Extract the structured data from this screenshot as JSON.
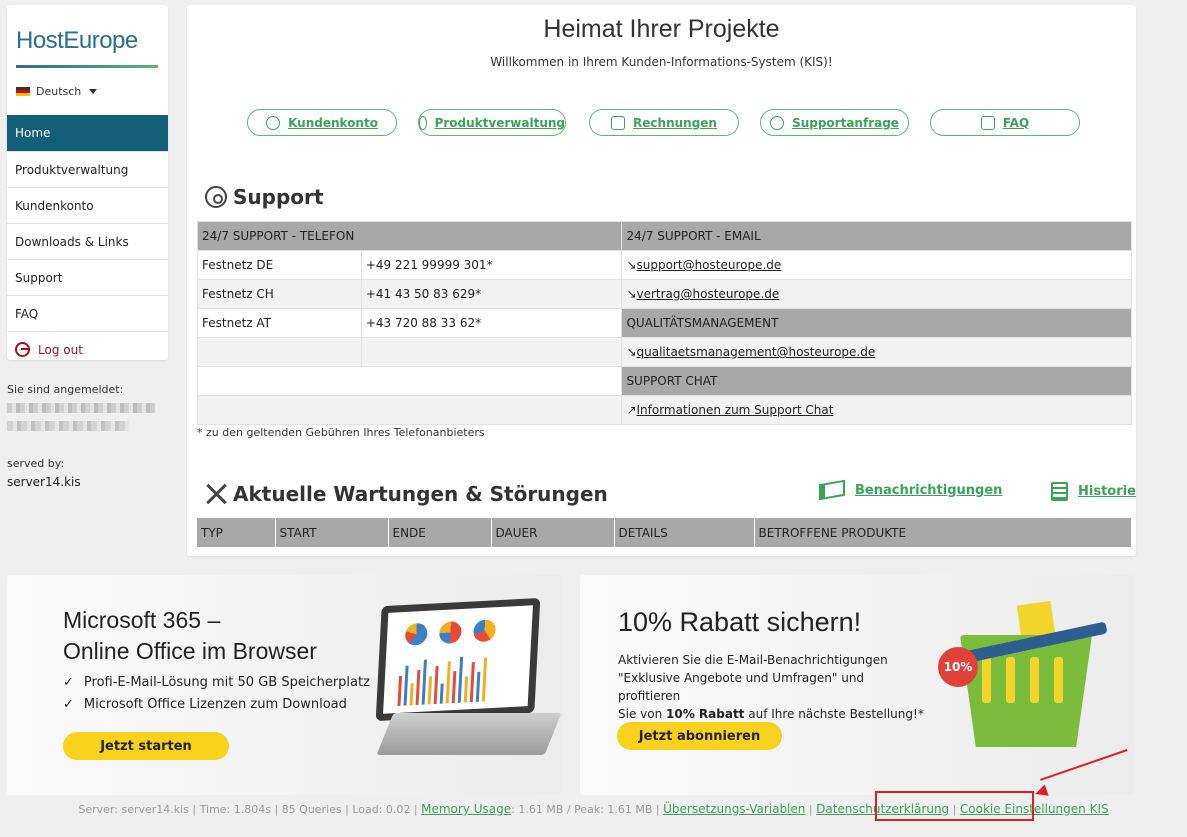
{
  "brand": {
    "logo_text": "HostEurope"
  },
  "language": {
    "selected": "Deutsch"
  },
  "sidebar": {
    "items": [
      {
        "label": "Home"
      },
      {
        "label": "Produktverwaltung"
      },
      {
        "label": "Kundenkonto"
      },
      {
        "label": "Downloads & Links"
      },
      {
        "label": "Support"
      },
      {
        "label": "FAQ"
      }
    ],
    "logout_label": "Log out",
    "logged_in_label": "Sie sind angemeldet:",
    "served_by_label": "served by:",
    "served_by_value": "server14.kis"
  },
  "main": {
    "title": "Heimat Ihrer Projekte",
    "subtitle": "Willkommen in Ihrem Kunden-Informations-System (KIS)!",
    "quick_links": [
      "Kundenkonto",
      "Produktverwaltung",
      "Rechnungen",
      "Supportanfrage",
      "FAQ"
    ]
  },
  "support": {
    "heading": "Support",
    "phone_header": "24/7 SUPPORT - TELEFON",
    "email_header": "24/7 SUPPORT - EMAIL",
    "phones": [
      {
        "label": "Festnetz DE",
        "number": "+49 221 99999 301*"
      },
      {
        "label": "Festnetz CH",
        "number": "+41 43 50 83 629*"
      },
      {
        "label": "Festnetz AT",
        "number": "+43 720 88 33 62*"
      }
    ],
    "emails": [
      "support@hosteurope.de",
      "vertrag@hosteurope.de"
    ],
    "quality_header": "QUALITÄTSMANAGEMENT",
    "quality_email": "qualitaetsmanagement@hosteurope.de",
    "chat_header": "SUPPORT CHAT",
    "chat_link": "Informationen zum Support Chat",
    "footnote": "* zu den geltenden Gebühren Ihres Telefonanbieters"
  },
  "maintenance": {
    "heading": "Aktuelle Wartungen & Störungen",
    "notifications_link": "Benachrichtigungen",
    "history_link": "Historie",
    "columns": [
      "TYP",
      "START",
      "ENDE",
      "DAUER",
      "DETAILS",
      "BETROFFENE PRODUKTE"
    ]
  },
  "banner_office": {
    "title_line1": "Microsoft 365 –",
    "title_line2": "Online Office im Browser",
    "bullets": [
      "Profi-E-Mail-Lösung mit 50 GB Speicherplatz",
      "Microsoft Office Lizenzen zum Download"
    ],
    "cta": "Jetzt starten"
  },
  "banner_discount": {
    "title": "10% Rabatt sichern!",
    "text_line1": "Aktivieren Sie die E-Mail-Benachrichtigungen",
    "text_line2": "\"Exklusive Angebote und Umfragen\" und profitieren",
    "text_line3_pre": "Sie von ",
    "text_line3_bold": "10% Rabatt",
    "text_line3_post": " auf Ihre nächste Bestellung!*",
    "badge": "10%",
    "cta": "Jetzt abonnieren"
  },
  "footer": {
    "server": "Server: server14.kis | Time: 1.804s | 85 Queries | Load: 0.02 |",
    "memory_link": "Memory Usage",
    "memory_text": ": 1.61 MB / Peak: 1.61 MB |",
    "translation_link": "Übersetzungs-Variablen",
    "privacy_link": "Datenschutzerklärung",
    "cookie_link": "Cookie Einstellungen KIS"
  },
  "colors": {
    "accent": "#135e7a",
    "green": "#3aa35a",
    "yellow": "#f8d21c",
    "highlight": "#e02020"
  }
}
